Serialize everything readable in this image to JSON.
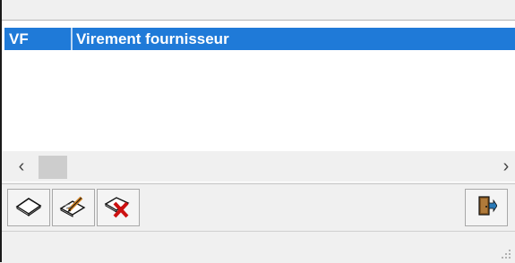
{
  "list": {
    "selected_row": {
      "code": "VF",
      "label": "Virement fournisseur"
    }
  },
  "scrollbar": {
    "left_arrow": "‹",
    "right_arrow": "›"
  },
  "toolbar": {
    "buttons": [
      {
        "icon": "eraser-new-icon"
      },
      {
        "icon": "edit-pencil-icon"
      },
      {
        "icon": "delete-x-icon"
      }
    ],
    "exit_button_icon": "exit-door-icon"
  },
  "colors": {
    "selection": "#1f7ad8",
    "background": "#f0f0f0",
    "list_background": "#ffffff",
    "delete_red": "#cc1111"
  }
}
